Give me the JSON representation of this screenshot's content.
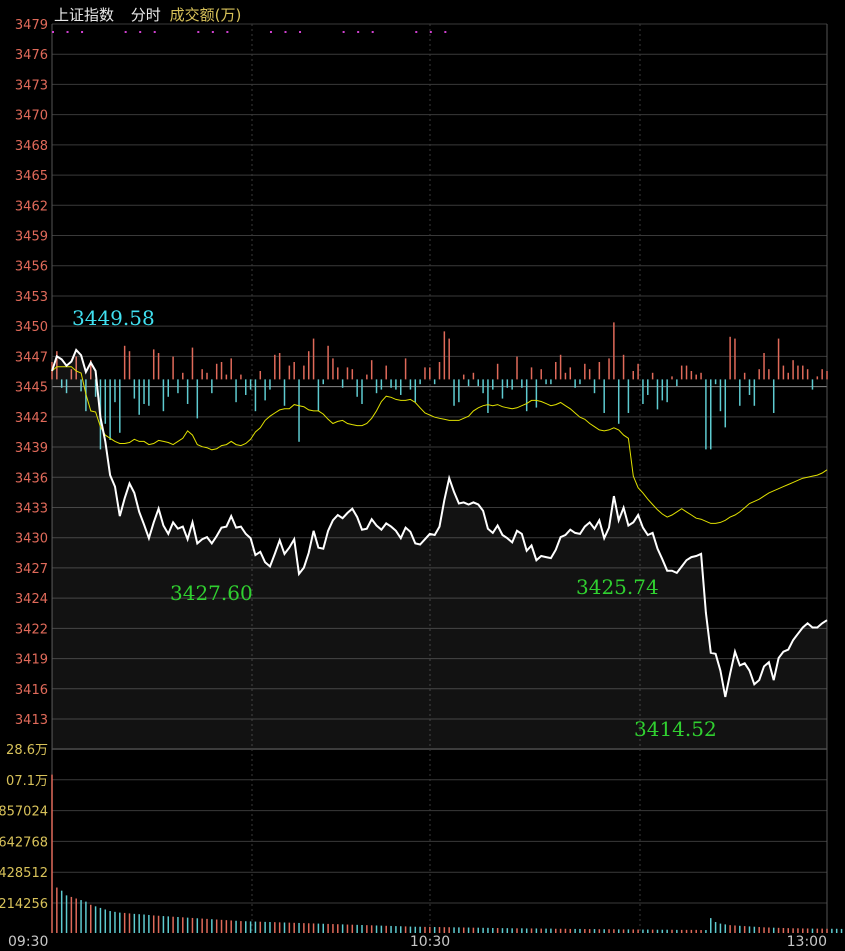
{
  "header": {
    "index_name": "上证指数",
    "mode": "分时",
    "indicator": "成交额(万)"
  },
  "colors": {
    "background": "#000000",
    "grid": "#3a3a3a",
    "price_line": "#ffffff",
    "avg_line": "#e0e000",
    "up": "#e06a5a",
    "down": "#5ecbd0",
    "price_tick": "#e06a5a",
    "volume_tick": "#d8c25a",
    "time_tick": "#c8c8c8",
    "header_text": "#e8e8e8",
    "indicator_text": "#d8c25a",
    "high_label": "#40e0f0",
    "low_label": "#30d030",
    "signal_dots": "#d040d0"
  },
  "annotations": {
    "high": "3449.58",
    "low_1": "3427.60",
    "low_2": "3425.74",
    "low_3": "3414.52"
  },
  "chart_data": {
    "type": "line",
    "title": "上证指数 分时",
    "x_ticks": [
      "09:30",
      "10:30",
      "13:00"
    ],
    "price_ticks": [
      "3479",
      "3476",
      "3473",
      "3470",
      "3468",
      "3465",
      "3462",
      "3459",
      "3456",
      "3453",
      "3450",
      "3447",
      "3445",
      "3442",
      "3439",
      "3436",
      "3433",
      "3430",
      "3427",
      "3424",
      "3422",
      "3419",
      "3416",
      "3413"
    ],
    "price_ylim": [
      3412.9,
      3479.0
    ],
    "prev_close": 3445.2,
    "volume_ticks": [
      "28.6万",
      "07.1万",
      "857024",
      "642768",
      "428512",
      "214256"
    ],
    "volume_ylim": [
      0,
      1071280
    ],
    "series": [
      {
        "name": "price",
        "values": [
          3446.0,
          3447.4,
          3447.1,
          3446.5,
          3446.9,
          3448.0,
          3447.5,
          3445.9,
          3446.8,
          3446.0,
          3441.6,
          3439.3,
          3436.1,
          3435.0,
          3432.2,
          3433.9,
          3435.3,
          3434.4,
          3432.6,
          3431.4,
          3430.1,
          3431.6,
          3432.9,
          3431.3,
          3430.5,
          3431.6,
          3431.0,
          3431.2,
          3430.0,
          3431.6,
          3429.6,
          3430.0,
          3430.2,
          3429.6,
          3430.3,
          3431.1,
          3431.2,
          3432.2,
          3431.1,
          3431.2,
          3430.5,
          3430.1,
          3428.5,
          3428.8,
          3427.8,
          3427.4,
          3428.6,
          3429.9,
          3428.6,
          3429.2,
          3430.0,
          3426.7,
          3427.3,
          3428.7,
          3430.8,
          3429.2,
          3429.1,
          3430.8,
          3431.8,
          3432.3,
          3432.0,
          3432.5,
          3432.9,
          3432.1,
          3430.9,
          3431.0,
          3431.9,
          3431.3,
          3430.9,
          3431.5,
          3431.2,
          3430.8,
          3430.1,
          3431.1,
          3430.7,
          3429.6,
          3429.5,
          3430.0,
          3430.5,
          3430.4,
          3431.2,
          3433.7,
          3435.8,
          3434.5,
          3433.4,
          3433.5,
          3433.3,
          3433.5,
          3433.3,
          3432.7,
          3431.0,
          3430.6,
          3431.3,
          3430.4,
          3430.1,
          3429.7,
          3430.8,
          3430.5,
          3428.9,
          3429.4,
          3428.0,
          3428.4,
          3428.3,
          3428.2,
          3429.0,
          3430.2,
          3430.4,
          3430.9,
          3430.6,
          3430.5,
          3431.2,
          3431.6,
          3431.0,
          3431.8,
          3430.1,
          3431.1,
          3434.1,
          3431.8,
          3433.0,
          3431.3,
          3431.6,
          3432.3,
          3431.1,
          3430.4,
          3430.6,
          3429.1,
          3428.1,
          3427.0,
          3427.0,
          3426.8,
          3427.4,
          3428.0,
          3428.3,
          3428.4,
          3428.6,
          3423.0,
          3419.2,
          3419.1,
          3417.5,
          3415.0,
          3417.2,
          3419.3,
          3418.0,
          3418.2,
          3417.5,
          3416.2,
          3416.6,
          3417.9,
          3418.3,
          3416.6,
          3418.7,
          3419.3,
          3419.5,
          3420.4,
          3421.0,
          3421.6,
          3422.0,
          3421.6,
          3421.6,
          3422.0,
          3422.3
        ]
      },
      {
        "name": "average",
        "values": [
          3446.0,
          3446.4,
          3446.4,
          3446.4,
          3446.4,
          3446.0,
          3445.8,
          3443.8,
          3442.2,
          3442.1,
          3440.7,
          3439.9,
          3439.6,
          3439.3,
          3439.1,
          3439.1,
          3439.2,
          3439.5,
          3439.3,
          3439.3,
          3439.0,
          3439.1,
          3439.4,
          3439.3,
          3439.2,
          3439.0,
          3439.3,
          3439.6,
          3440.3,
          3439.9,
          3439.0,
          3438.8,
          3438.7,
          3438.5,
          3438.6,
          3438.9,
          3439.0,
          3439.3,
          3439.0,
          3438.9,
          3439.1,
          3439.5,
          3440.2,
          3440.6,
          3441.3,
          3441.7,
          3442.0,
          3442.3,
          3442.4,
          3442.4,
          3442.8,
          3442.7,
          3442.6,
          3442.3,
          3442.2,
          3442.2,
          3441.9,
          3441.4,
          3441.0,
          3441.2,
          3441.3,
          3441.0,
          3440.9,
          3440.8,
          3440.8,
          3441.0,
          3441.5,
          3442.2,
          3443.1,
          3443.6,
          3443.5,
          3443.3,
          3443.2,
          3443.2,
          3443.3,
          3443.0,
          3442.5,
          3442.0,
          3441.8,
          3441.6,
          3441.5,
          3441.4,
          3441.3,
          3441.3,
          3441.3,
          3441.5,
          3441.7,
          3442.2,
          3442.5,
          3442.7,
          3442.8,
          3442.7,
          3442.8,
          3442.6,
          3442.5,
          3442.4,
          3442.5,
          3442.7,
          3442.9,
          3443.2,
          3443.2,
          3443.1,
          3442.9,
          3442.7,
          3442.8,
          3443.0,
          3442.7,
          3442.4,
          3442.0,
          3441.6,
          3441.4,
          3441.0,
          3440.7,
          3440.4,
          3440.3,
          3440.4,
          3440.6,
          3440.4,
          3439.9,
          3439.6,
          3436.0,
          3434.9,
          3434.4,
          3433.8,
          3433.3,
          3432.8,
          3432.4,
          3432.1,
          3432.3,
          3432.6,
          3432.9,
          3432.6,
          3432.3,
          3432.0,
          3431.9,
          3431.7,
          3431.5,
          3431.5,
          3431.6,
          3431.8,
          3432.1,
          3432.3,
          3432.6,
          3433.0,
          3433.4,
          3433.6,
          3433.8,
          3434.1,
          3434.4,
          3434.6,
          3434.8,
          3435.0,
          3435.2,
          3435.4,
          3435.6,
          3435.8,
          3435.9,
          3436.0,
          3436.1,
          3436.3,
          3436.6
        ]
      },
      {
        "name": "volume",
        "values": [
          1010000,
          290000,
          270000,
          240000,
          230000,
          220000,
          210000,
          200000,
          180000,
          170000,
          160000,
          150000,
          140000,
          135000,
          130000,
          128000,
          125000,
          122000,
          120000,
          118000,
          115000,
          112000,
          110000,
          108000,
          106000,
          104000,
          102000,
          100000,
          98000,
          96000,
          94000,
          92000,
          90000,
          88000,
          86000,
          84000,
          82000,
          80000,
          78000,
          76000,
          75000,
          74000,
          73000,
          72000,
          71000,
          70000,
          69000,
          68000,
          67000,
          66000,
          65000,
          64000,
          63000,
          62000,
          61000,
          60000,
          59000,
          58000,
          57000,
          56000,
          55000,
          54000,
          53000,
          52000,
          51000,
          50000,
          49000,
          48000,
          47000,
          46000,
          45000,
          44000,
          43000,
          42000,
          41000,
          40000,
          40000,
          39000,
          39000,
          38000,
          38000,
          37000,
          37000,
          36000,
          36000,
          35000,
          35000,
          34000,
          34000,
          33000,
          33000,
          32000,
          32000,
          31000,
          31000,
          30000,
          30000,
          30000,
          29000,
          29000,
          29000,
          28000,
          28000,
          28000,
          27000,
          27000,
          27000,
          26000,
          26000,
          26000,
          25000,
          25000,
          25000,
          24000,
          24000,
          24000,
          24000,
          23000,
          23000,
          23000,
          23000,
          22000,
          22000,
          22000,
          22000,
          21000,
          21000,
          21000,
          21000,
          20000,
          20000,
          20000,
          20000,
          20000,
          19000,
          19000,
          95000,
          70000,
          60000,
          55000,
          50000,
          48000,
          46000,
          44000,
          42000,
          40000,
          38000,
          36000,
          35000,
          34000,
          33000,
          32000,
          31000,
          30000,
          30000,
          29000,
          29000,
          28000,
          28000,
          28000,
          27000,
          27000,
          27000,
          26000,
          26000,
          26000
        ]
      }
    ]
  }
}
